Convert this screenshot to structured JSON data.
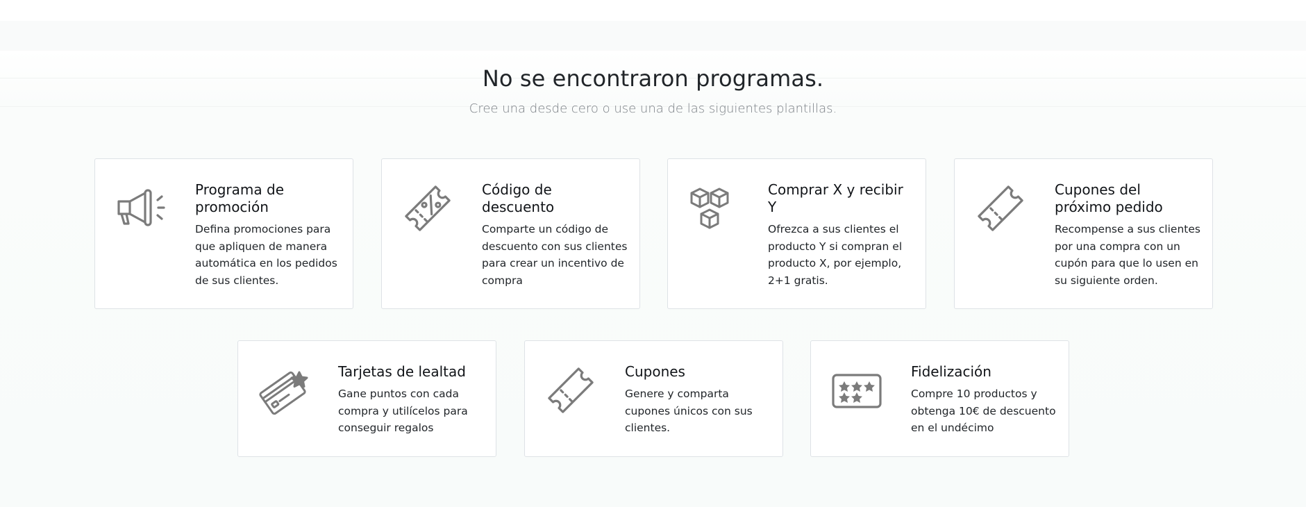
{
  "empty_state": {
    "title": "No se encontraron programas.",
    "subtitle": "Cree una desde cero o use una de las siguientes plantillas."
  },
  "templates": [
    {
      "title": "Programa de promoción",
      "description": "Defina promociones para que apliquen de manera automática en los pedidos de sus clientes.",
      "icon": "megaphone-icon"
    },
    {
      "title": "Código de descuento",
      "description": "Comparte un código de descuento con sus clientes para crear un incentivo de compra",
      "icon": "discount-ticket-icon"
    },
    {
      "title": "Comprar X y recibir Y",
      "description": "Ofrezca a sus clientes el producto Y si compran el producto X, por ejemplo, 2+1 gratis.",
      "icon": "boxes-icon"
    },
    {
      "title": "Cupones del próximo pedido",
      "description": "Recompense a sus clientes por una compra con un cupón para que lo usen en su siguiente orden.",
      "icon": "coupon-ticket-icon"
    },
    {
      "title": "Tarjetas de lealtad",
      "description": "Gane puntos con cada compra y utilícelos para conseguir regalos",
      "icon": "loyalty-card-icon"
    },
    {
      "title": "Cupones",
      "description": "Genere y comparta cupones únicos con sus clientes.",
      "icon": "coupon-ticket-icon"
    },
    {
      "title": "Fidelización",
      "description": "Compre 10 productos y obtenga 10€ de descuento en el undécimo",
      "icon": "stamp-card-icon"
    }
  ],
  "colors": {
    "icon": "#7b7b7b",
    "border": "#dee2e6",
    "subtitle": "#7a7f85"
  }
}
